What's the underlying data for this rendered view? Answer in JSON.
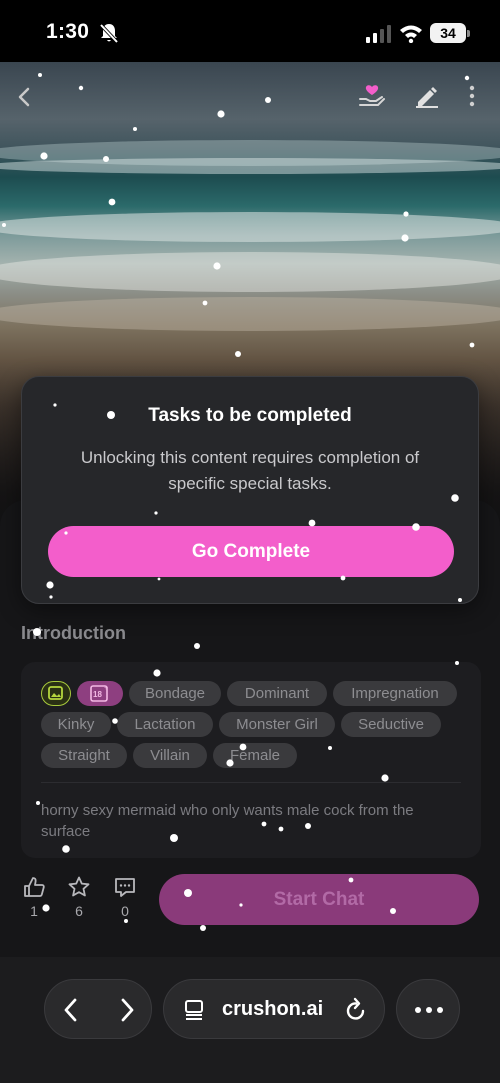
{
  "status_bar": {
    "time": "1:30",
    "battery": "34"
  },
  "modal": {
    "title": "Tasks to be completed",
    "body": "Unlocking this content requires completion of specific special tasks.",
    "button_label": "Go Complete"
  },
  "introduction": {
    "heading": "Introduction",
    "tags": [
      "Bondage",
      "Dominant",
      "Impregnation",
      "Kinky",
      "Lactation",
      "Monster Girl",
      "Seductive",
      "Straight",
      "Villain",
      "Female"
    ],
    "description": "horny sexy mermaid who only wants male cock from the surface"
  },
  "actions": {
    "likes": "1",
    "stars": "6",
    "comments": "0",
    "start_chat_label": "Start Chat"
  },
  "browser": {
    "url": "crushon.ai"
  },
  "colors": {
    "accent": "#f35ecb",
    "start_chat": "#8a3a7a"
  }
}
